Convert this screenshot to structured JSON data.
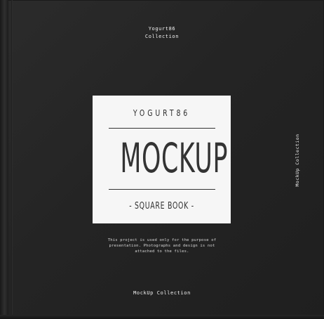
{
  "cover": {
    "background_color": "#232323",
    "card_color": "#f6f6f6",
    "top_label": {
      "line1": "Yogurt86",
      "line2": "Collection"
    },
    "card": {
      "brand": "YOGURT86",
      "title": "MOCKUP",
      "subtitle": "- SQUARE BOOK -"
    },
    "description": {
      "line1": "This project is used only for the purpose of",
      "line2": "presentation. Photographs and design is not",
      "line3": "attached to the files."
    },
    "bottom_label": "MockUp Collection",
    "side_label": "MockUp Collection"
  }
}
